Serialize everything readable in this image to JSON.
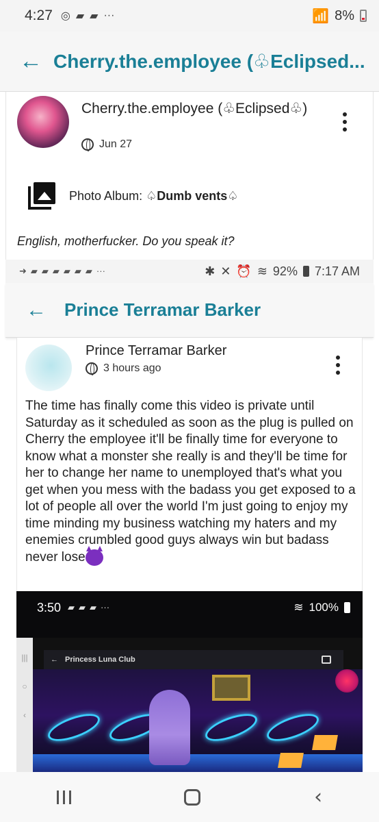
{
  "status_bar": {
    "time": "4:27",
    "icons": [
      "notification-icon",
      "discord-icon",
      "discord-icon",
      "more-notifications-icon"
    ],
    "battery": "8%"
  },
  "app_bar": {
    "back_icon": "←",
    "title": "Cherry.the.employee (♧Eclipsed..."
  },
  "post": {
    "author": "Cherry.the.employee (♧Eclipsed♧)",
    "date": "Jun 27",
    "album_label": "Photo Album: ",
    "album_name": "♤Dumb vents♤",
    "caption": "English, motherfucker. Do you speak it?"
  },
  "embedded_1": {
    "status": {
      "battery": "92%",
      "time": "7:17 AM"
    },
    "app_bar": {
      "back_icon": "←",
      "title": "Prince Terramar Barker"
    },
    "post": {
      "author": "Prince Terramar Barker",
      "time_ago": "3 hours ago",
      "body": "The time has finally come this video is private until Saturday as it scheduled as soon as the plug is pulled on Cherry the employee it'll be finally time for everyone to know what a monster she really is and they'll be time for her to change her name to unemployed that's what you get when you mess with the badass you get exposed to a lot of people all over the world I'm just going to enjoy my time minding my business watching my haters and my enemies crumbled good guys always win but badass never lose"
    }
  },
  "embedded_2": {
    "status": {
      "time": "3:50",
      "battery": "100%"
    },
    "app_bar": {
      "title": "Princess Luna Club"
    }
  },
  "colors": {
    "accent": "#1a7f96",
    "background": "#ffffff"
  }
}
